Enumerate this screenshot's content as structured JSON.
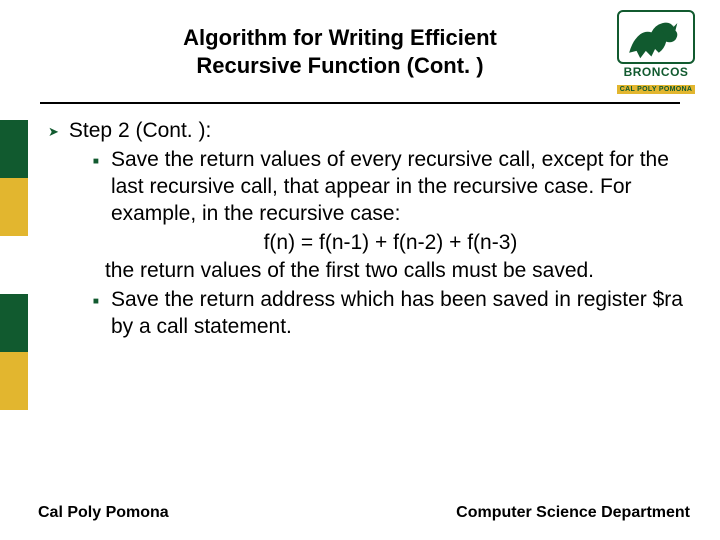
{
  "title_line1": "Algorithm for Writing Efficient",
  "title_line2": "Recursive Function (Cont. )",
  "logo": {
    "name": "BRONCOS",
    "subname": "CAL POLY POMONA"
  },
  "step_heading": "Step 2 (Cont. ):",
  "bullet1_a": "Save the return values of every recursive call, except for the last recursive call, that appear in the recursive case. For example, in the recursive case:",
  "formula": "f(n) = f(n-1) + f(n-2) + f(n-3)",
  "bullet1_b": "the return values of the first two calls must be saved.",
  "bullet2": "Save the return address which has been saved in register $ra by a call statement.",
  "footer_left": "Cal Poly Pomona",
  "footer_right": "Computer Science Department"
}
